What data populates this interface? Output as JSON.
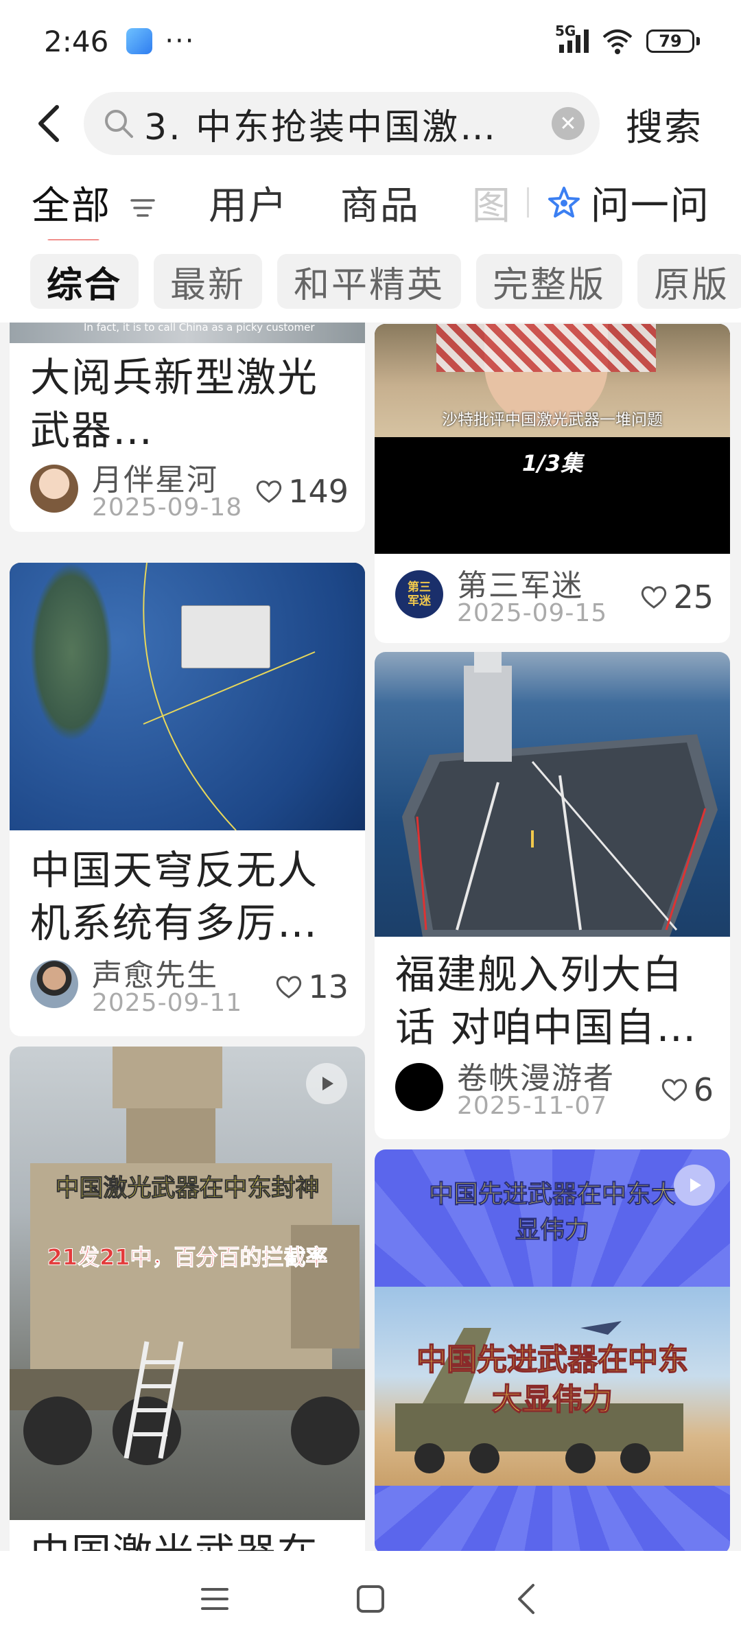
{
  "status_bar": {
    "time": "2:46",
    "dots": "···",
    "network": "5G",
    "battery": "79"
  },
  "search": {
    "query": "3. 中东抢装中国激…",
    "clear_symbol": "✕",
    "button": "搜索"
  },
  "tabs": [
    {
      "label": "全部"
    },
    {
      "label": "用户"
    },
    {
      "label": "商品"
    },
    {
      "label": "图"
    }
  ],
  "ask_tab": {
    "label": "问一问"
  },
  "chips": [
    "综合",
    "最新",
    "和平精英",
    "完整版",
    "原版"
  ],
  "cards": {
    "c1": {
      "thumb_caption": "In fact, it is to call China as a picky customer",
      "title_line1": "大阅兵新型激光",
      "title_line2": "武器…",
      "author": "月伴星河",
      "date": "2025-09-18",
      "likes": "149"
    },
    "c2": {
      "subtitle": "沙特批评中国激光武器一堆问题",
      "episode": "1/3集",
      "author": "第三军迷",
      "avatar_text_top": "第三",
      "avatar_text_bottom": "军迷",
      "date": "2025-09-15",
      "likes": "25"
    },
    "c3": {
      "title_line1": "中国天穹反无人",
      "title_line2": "机系统有多厉…",
      "author": "声愈先生",
      "date": "2025-09-11",
      "likes": "13"
    },
    "c4": {
      "title_line1": "福建舰入列大白",
      "title_line2": "话 对咱中国自…",
      "author": "卷帙漫游者",
      "date": "2025-11-07",
      "likes": "6"
    },
    "c5": {
      "caption_yellow": "中国激光武器在中东封神",
      "caption_red": "21发21中，百分百的拦截率",
      "title_partial": "中国激光武器在"
    },
    "c6": {
      "banner_line1": "中国先进武器在中东大",
      "banner_line2": "显伟力",
      "overlay_line1": "中国先进武器在中东",
      "overlay_line2": "大显伟力"
    }
  },
  "colors": {
    "accent": "#e4312b",
    "ask_blue": "#3b7ff2",
    "banner_blue": "#5660e8"
  }
}
